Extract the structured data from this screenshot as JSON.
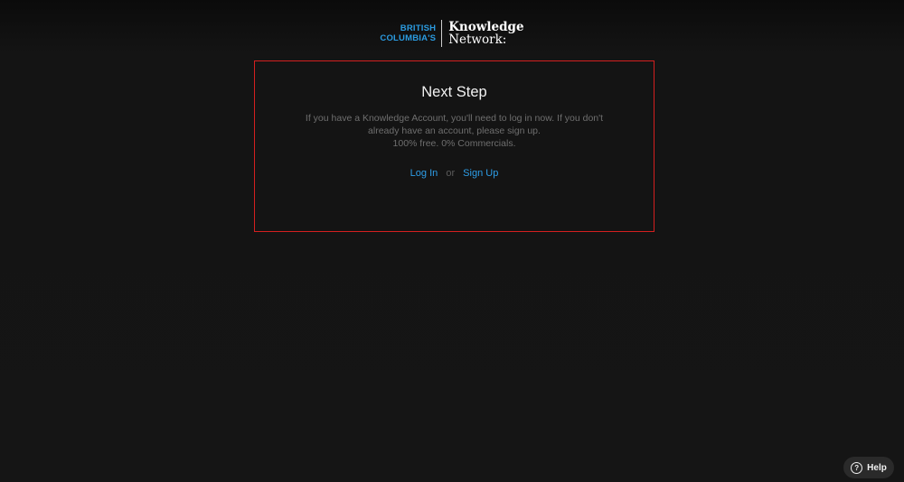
{
  "logo": {
    "left_line1": "BRITISH",
    "left_line2": "COLUMBIA'S",
    "right_line1": "Knowledge",
    "right_line2": "Network:"
  },
  "card": {
    "title": "Next Step",
    "body_line1": "If you have a Knowledge Account, you'll need to log in now. If you don't",
    "body_line2": "already have an account, please sign up.",
    "body_line3": "100% free. 0% Commercials.",
    "login_label": "Log In",
    "or_label": "or",
    "signup_label": "Sign Up"
  },
  "help": {
    "icon": "question-circle-icon",
    "label": "Help"
  },
  "colors": {
    "background": "#141414",
    "accent": "#2d9ee8",
    "highlight_border": "#d41f1f"
  }
}
